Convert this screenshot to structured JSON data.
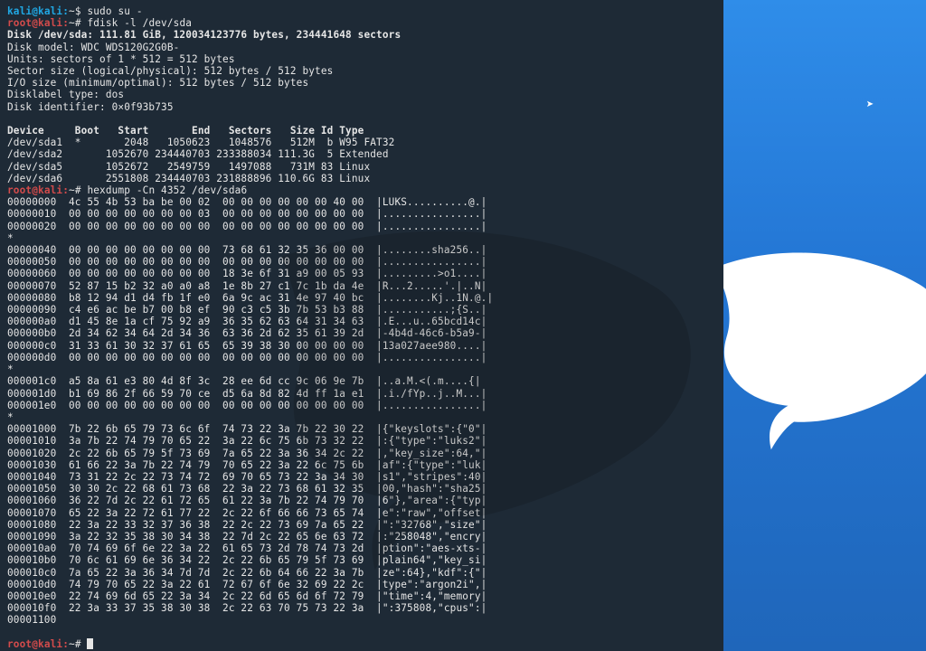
{
  "prompt_user": {
    "user": "kali",
    "host": "kali",
    "sep": "~$ "
  },
  "prompt_root": {
    "user": "root",
    "host": "kali",
    "sep": "~# "
  },
  "cmd_sudo": "sudo su -",
  "cmd_fdisk": "fdisk -l /dev/sda",
  "fdisk_header": [
    "Disk /dev/sda: 111.81 GiB, 120034123776 bytes, 234441648 sectors",
    "Disk model: WDC WDS120G2G0B-",
    "Units: sectors of 1 * 512 = 512 bytes",
    "Sector size (logical/physical): 512 bytes / 512 bytes",
    "I/O size (minimum/optimal): 512 bytes / 512 bytes",
    "Disklabel type: dos",
    "Disk identifier: 0×0f93b735"
  ],
  "fdisk_tbl_hdr": "Device     Boot   Start       End   Sectors   Size Id Type",
  "fdisk_rows": [
    "/dev/sda1  *       2048   1050623   1048576   512M  b W95 FAT32",
    "/dev/sda2       1052670 234440703 233388034 111.3G  5 Extended",
    "/dev/sda5       1052672   2549759   1497088   731M 83 Linux",
    "/dev/sda6       2551808 234440703 231888896 110.6G 83 Linux"
  ],
  "cmd_hexdump": "hexdump -Cn 4352 /dev/sda6",
  "hexdump": [
    "00000000  4c 55 4b 53 ba be 00 02  00 00 00 00 00 00 40 00  |LUKS..........@.|",
    "00000010  00 00 00 00 00 00 00 03  00 00 00 00 00 00 00 00  |................|",
    "00000020  00 00 00 00 00 00 00 00  00 00 00 00 00 00 00 00  |................|",
    "*",
    "00000040  00 00 00 00 00 00 00 00  73 68 61 32 35 36 00 00  |........sha256..|",
    "00000050  00 00 00 00 00 00 00 00  00 00 00 00 00 00 00 00  |................|",
    "00000060  00 00 00 00 00 00 00 00  18 3e 6f 31 a9 00 05 93  |.........>o1....|",
    "00000070  52 87 15 b2 32 a0 a0 a8  1e 8b 27 c1 7c 1b da 4e  |R...2.....'.|..N|",
    "00000080  b8 12 94 d1 d4 fb 1f e0  6a 9c ac 31 4e 97 40 bc  |........Kj..1N.@.|",
    "00000090  c4 e6 ac be b7 00 b8 ef  90 c3 c5 3b 7b 53 b3 88  |...........;{S..|",
    "000000a0  d1 45 8e 1a cf 75 92 a9  36 35 62 63 64 31 34 63  |.E...u..65bcd14c|",
    "000000b0  2d 34 62 34 64 2d 34 36  63 36 2d 62 35 61 39 2d  |-4b4d-46c6-b5a9-|",
    "000000c0  31 33 61 30 32 37 61 65  65 39 38 30 00 00 00 00  |13a027aee980....|",
    "000000d0  00 00 00 00 00 00 00 00  00 00 00 00 00 00 00 00  |................|",
    "*",
    "000001c0  a5 8a 61 e3 80 4d 8f 3c  28 ee 6d cc 9c 06 9e 7b  |..a.M.<(.m....{|",
    "000001d0  b1 69 86 2f 66 59 70 ce  d5 6a 8d 82 4d ff 1a e1  |.i./fYp..j..M...|",
    "000001e0  00 00 00 00 00 00 00 00  00 00 00 00 00 00 00 00  |................|",
    "*",
    "00001000  7b 22 6b 65 79 73 6c 6f  74 73 22 3a 7b 22 30 22  |{\"keyslots\":{\"0\"|",
    "00001010  3a 7b 22 74 79 70 65 22  3a 22 6c 75 6b 73 32 22  |:{\"type\":\"luks2\"|",
    "00001020  2c 22 6b 65 79 5f 73 69  7a 65 22 3a 36 34 2c 22  |,\"key_size\":64,\"|",
    "00001030  61 66 22 3a 7b 22 74 79  70 65 22 3a 22 6c 75 6b  |af\":{\"type\":\"luk|",
    "00001040  73 31 22 2c 22 73 74 72  69 70 65 73 22 3a 34 30  |s1\",\"stripes\":40|",
    "00001050  30 30 2c 22 68 61 73 68  22 3a 22 73 68 61 32 35  |00,\"hash\":\"sha25|",
    "00001060  36 22 7d 2c 22 61 72 65  61 22 3a 7b 22 74 79 70  |6\"},\"area\":{\"typ|",
    "00001070  65 22 3a 22 72 61 77 22  2c 22 6f 66 66 73 65 74  |e\":\"raw\",\"offset|",
    "00001080  22 3a 22 33 32 37 36 38  22 2c 22 73 69 7a 65 22  |\":\"32768\",\"size\"|",
    "00001090  3a 22 32 35 38 30 34 38  22 7d 2c 22 65 6e 63 72  |:\"258048\",\"encry|",
    "000010a0  70 74 69 6f 6e 22 3a 22  61 65 73 2d 78 74 73 2d  |ption\":\"aes-xts-|",
    "000010b0  70 6c 61 69 6e 36 34 22  2c 22 6b 65 79 5f 73 69  |plain64\",\"key_si|",
    "000010c0  7a 65 22 3a 36 34 7d 7d  2c 22 6b 64 66 22 3a 7b  |ze\":64},\"kdf\":{\"|",
    "000010d0  74 79 70 65 22 3a 22 61  72 67 6f 6e 32 69 22 2c  |type\":\"argon2i\",|",
    "000010e0  22 74 69 6d 65 22 3a 34  2c 22 6d 65 6d 6f 72 79  |\"time\":4,\"memory|",
    "000010f0  22 3a 33 37 35 38 30 38  2c 22 63 70 75 73 22 3a  |\":375808,\"cpus\":|",
    "00001100"
  ]
}
